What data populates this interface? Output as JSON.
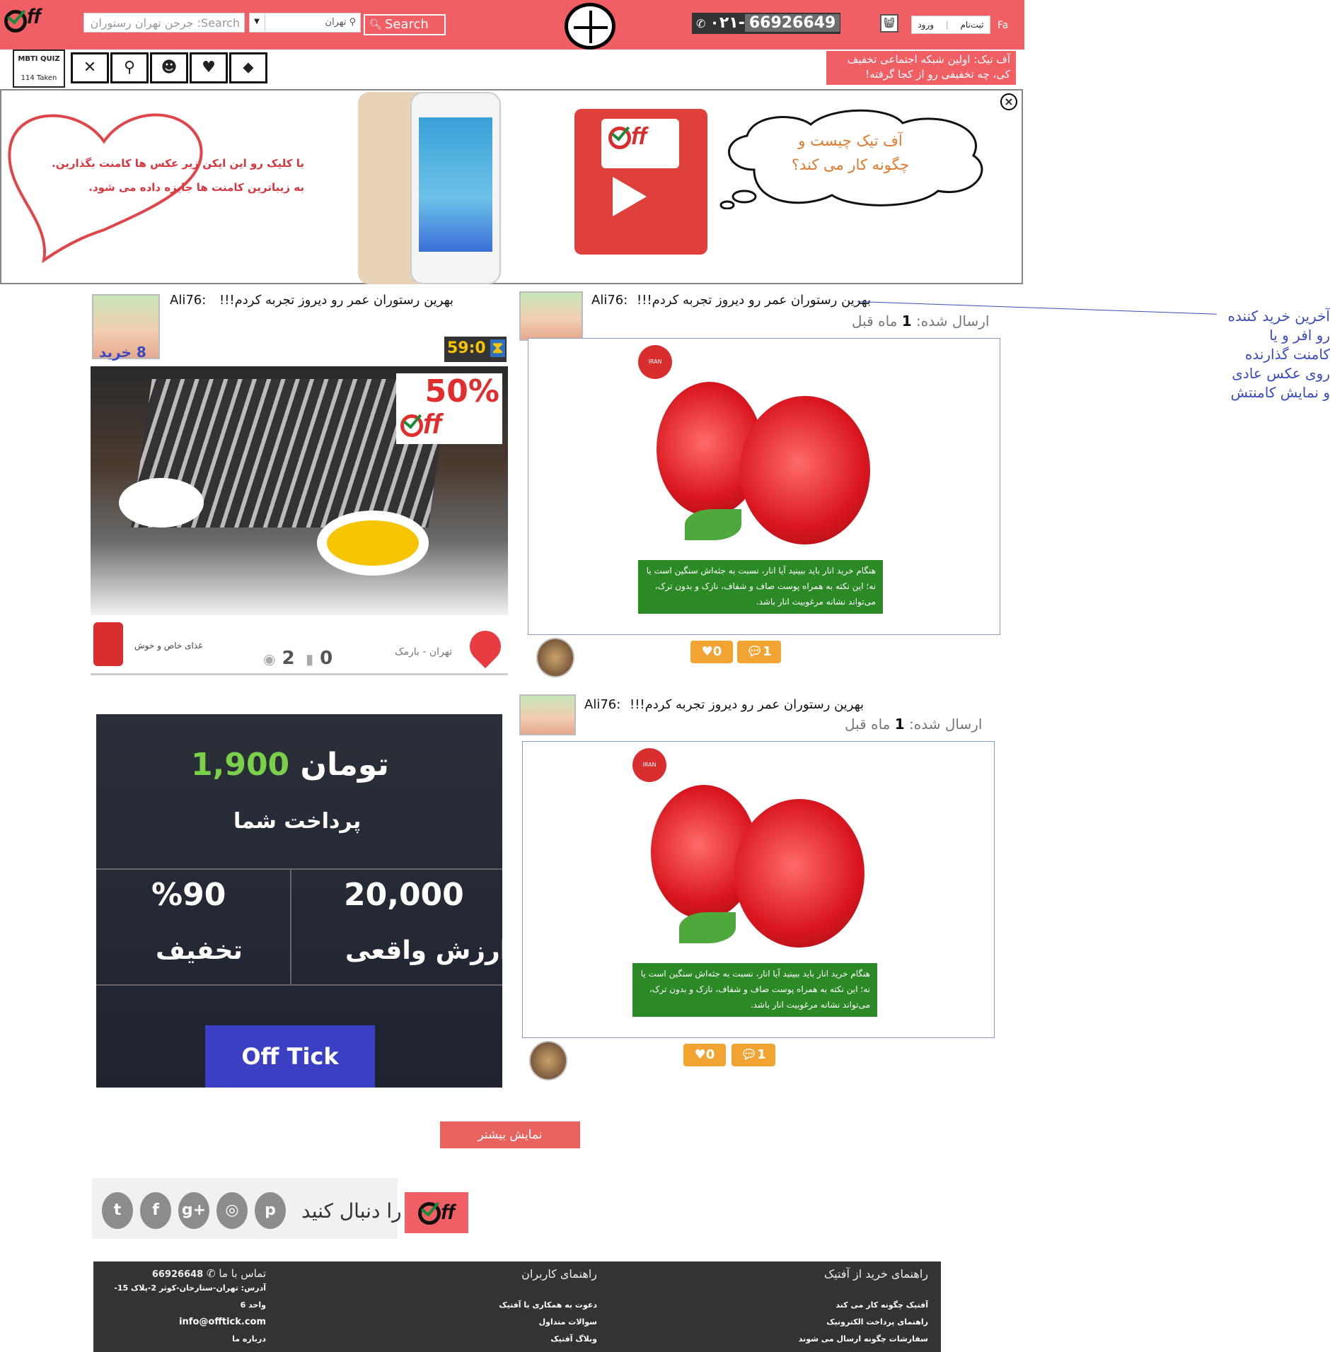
{
  "header": {
    "logo_text": "ff",
    "search_placeholder": "Search: جرجن تهران رستوران",
    "city": "تهران",
    "search_label": "Search",
    "phone_prefix": "۰۲۱-",
    "phone_number": "66926649",
    "login": "ورود",
    "signup": "ثبت‌نام",
    "lang": "Fa"
  },
  "categories": {
    "mbti_label": "MBTI QUIZ",
    "mbti_count": "114 Taken",
    "items": [
      "restaurant-icon",
      "bike-icon",
      "theater-icon",
      "heartbeat-icon",
      "tag-icon"
    ]
  },
  "tagline": "آف تیک: اولین شبکه اجتماعی تخفیف کی، چه تخفیفی رو از کجا گرفته!",
  "banner": {
    "heart_line1": "با کلیک رو این ایکن زیر عکس ها کامنت بگذارین.",
    "heart_line2": "به زیباترین کامنت ها جایزه داده می شود.",
    "cloud_line1": "آف تیک چیست و",
    "cloud_line2": "چگونه کار می کند؟",
    "close": "×"
  },
  "deal1": {
    "user": "Ali76:",
    "comment": "بهرین رستوران عمر رو دیروز تجربه کردم!!!",
    "bought": "8 خرید",
    "timer": "59:0",
    "discount": "50%",
    "vendor": "غذای خاص و خوش",
    "views": "2",
    "comments": "0",
    "location": "تهران - بارمک"
  },
  "posts": [
    {
      "user": "Ali76:",
      "comment": "بهرین رستوران عمر رو دیروز تجربه کردم!!!",
      "sent_prefix": "ارسال شده:",
      "sent_num": "1",
      "sent_suffix": "ماه قبل",
      "brand": "IRAN FOODS",
      "caption": "هنگام خرید انار باید ببینید آیا انار، نسبت به جثه‌اش سنگین است یا نه؛ این نکته به همراه پوست صاف و شفاف، نازک و بدون ترک، می‌تواند نشانه مرغوبیت انار باشد.",
      "likes": "0",
      "comments_count": "1"
    },
    {
      "user": "Ali76:",
      "comment": "بهرین رستوران عمر رو دیروز تجربه کردم!!!",
      "sent_prefix": "ارسال شده:",
      "sent_num": "1",
      "sent_suffix": "ماه قبل",
      "brand": "IRAN FOODS",
      "caption": "هنگام خرید انار باید ببینید آیا انار، نسبت به جثه‌اش سنگین است یا نه؛ این نکته به همراه پوست صاف و شفاف، نازک و بدون ترک، می‌تواند نشانه مرغوبیت انار باشد.",
      "likes": "0",
      "comments_count": "1"
    }
  ],
  "side_note": [
    "آخرین خرید کننده",
    "رو افر و یا",
    "کامنت گذارنده",
    "روی عکس عادی",
    "و نمایش کامنتش"
  ],
  "deal2": {
    "price": "1,900",
    "currency": "تومان",
    "pay_label": "پرداخت شما",
    "discount": "%90",
    "discount_label": "تخفیف",
    "real_value": "20,000",
    "real_label": "ارزش واقعی",
    "button": "Off Tick"
  },
  "more_button": "نمایش بیشتر",
  "social": {
    "follow": "را دنبال کنید",
    "icons": [
      "twitter-icon",
      "facebook-icon",
      "googleplus-icon",
      "instagram-icon",
      "pinterest-icon"
    ]
  },
  "footer": {
    "col1_title": "راهنمای خرید از آفتیک",
    "col1_links": [
      "آفتیک چگونه کار می کند",
      "راهنمای پرداخت الکترونیک",
      "سفارشات چگونه ارسال می شوند"
    ],
    "col2_title": "راهنمای کاربران",
    "col2_links": [
      "دعوت به همکاری با آفتیک",
      "سوالات متداول",
      "وبلاگ آفتیک"
    ],
    "col3_title": "تماس با ما",
    "phone": "66926648",
    "address": "آدرس: تهران-ستارخان-کوثر 2-پلاک 15-واحد 6",
    "email": "info@offtick.com",
    "about": "درباره ما"
  },
  "colors": {
    "brand": "#ef5f63",
    "deal_button": "#3b3fc4",
    "like_button": "#f2a433"
  }
}
